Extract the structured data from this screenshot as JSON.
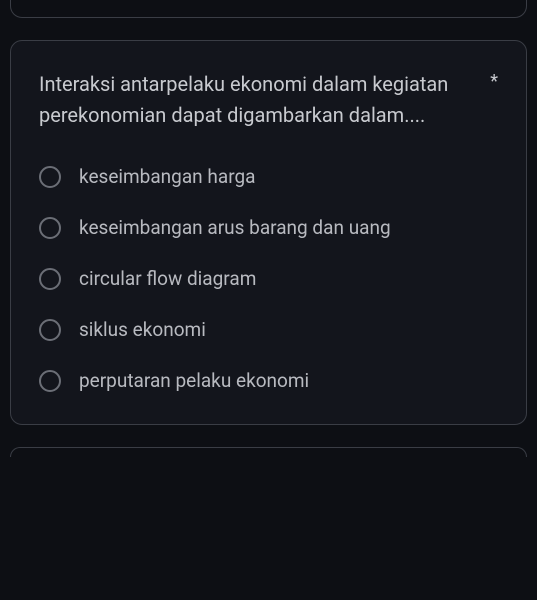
{
  "question": {
    "text": "Interaksi antarpelaku ekonomi dalam kegiatan perekonomian dapat digambarkan dalam....",
    "required_marker": "*"
  },
  "options": [
    {
      "label": "keseimbangan harga"
    },
    {
      "label": "keseimbangan arus barang dan uang"
    },
    {
      "label": "circular flow diagram"
    },
    {
      "label": "siklus ekonomi"
    },
    {
      "label": "perputaran pelaku ekonomi"
    }
  ]
}
